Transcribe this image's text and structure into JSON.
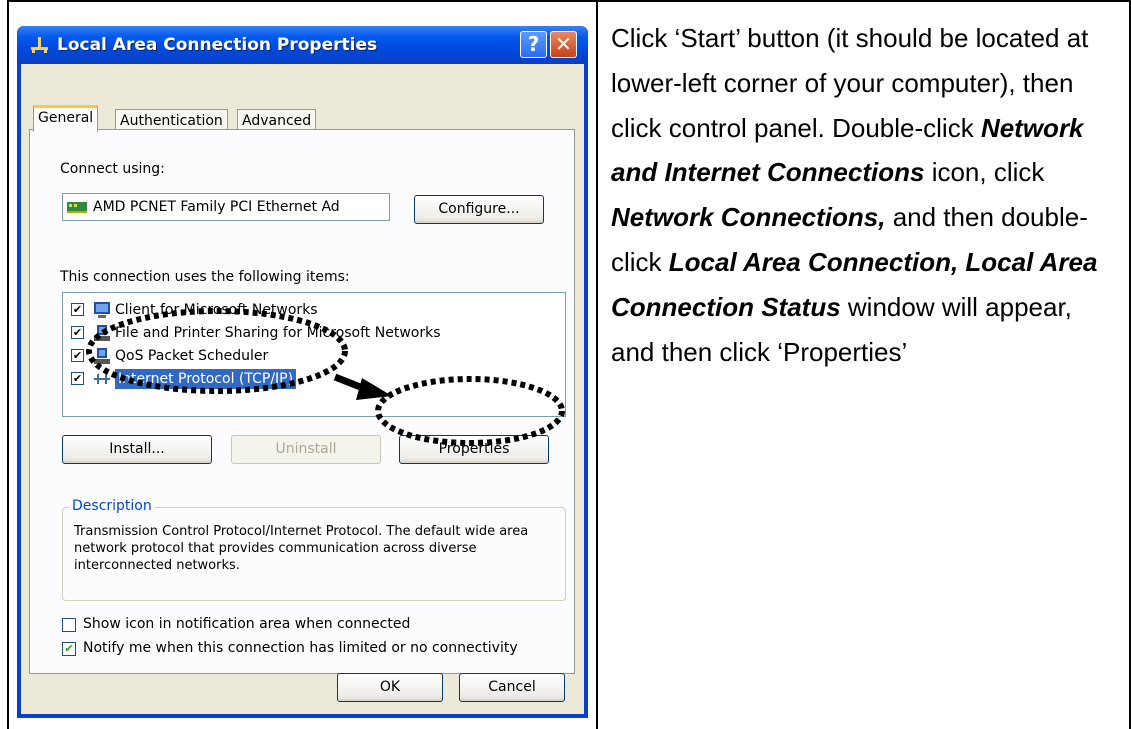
{
  "window": {
    "title": "Local Area Connection Properties",
    "help_label": "?",
    "close_label": "✕"
  },
  "tabs": [
    {
      "label": "General",
      "active": true
    },
    {
      "label": "Authentication",
      "active": false
    },
    {
      "label": "Advanced",
      "active": false
    }
  ],
  "connect_using": {
    "label": "Connect using:",
    "adapter": "AMD PCNET Family PCI Ethernet Ad",
    "configure_button": "Configure..."
  },
  "items_label": "This connection uses the following items:",
  "items": [
    {
      "label": "Client for Microsoft Networks",
      "checked": true,
      "icon": "network-client-icon"
    },
    {
      "label": "File and Printer Sharing for Microsoft Networks",
      "checked": true,
      "icon": "file-printer-sharing-icon"
    },
    {
      "label": "QoS Packet Scheduler",
      "checked": true,
      "icon": "qos-scheduler-icon"
    },
    {
      "label": "Internet Protocol (TCP/IP)",
      "checked": true,
      "selected": true,
      "icon": "protocol-icon"
    }
  ],
  "buttons": {
    "install": "Install...",
    "uninstall": "Uninstall",
    "properties": "Properties",
    "ok": "OK",
    "cancel": "Cancel"
  },
  "description": {
    "title": "Description",
    "text": "Transmission Control Protocol/Internet Protocol. The default wide area network protocol that provides communication across diverse interconnected networks."
  },
  "options": [
    {
      "label": "Show icon in notification area when connected",
      "checked": false
    },
    {
      "label": "Notify me when this connection has limited or no connectivity",
      "checked": true
    }
  ],
  "instructions": {
    "p1": "Click ‘Start’ button (it should be located at lower-left corner of your computer), then click control panel. Double-click ",
    "b1": "Network and Internet Connections",
    "p2": " icon, click ",
    "b2": "Network Connections,",
    "p3": " and then double-click ",
    "b3": "Local Area Connection, Local Area Connection Status",
    "p4": " window will appear, and then click ‘Properties’"
  },
  "colors": {
    "titlebar": "#0058ee",
    "client_bg": "#ece9d8",
    "selection": "#316ac5",
    "group_title": "#0046d5"
  }
}
